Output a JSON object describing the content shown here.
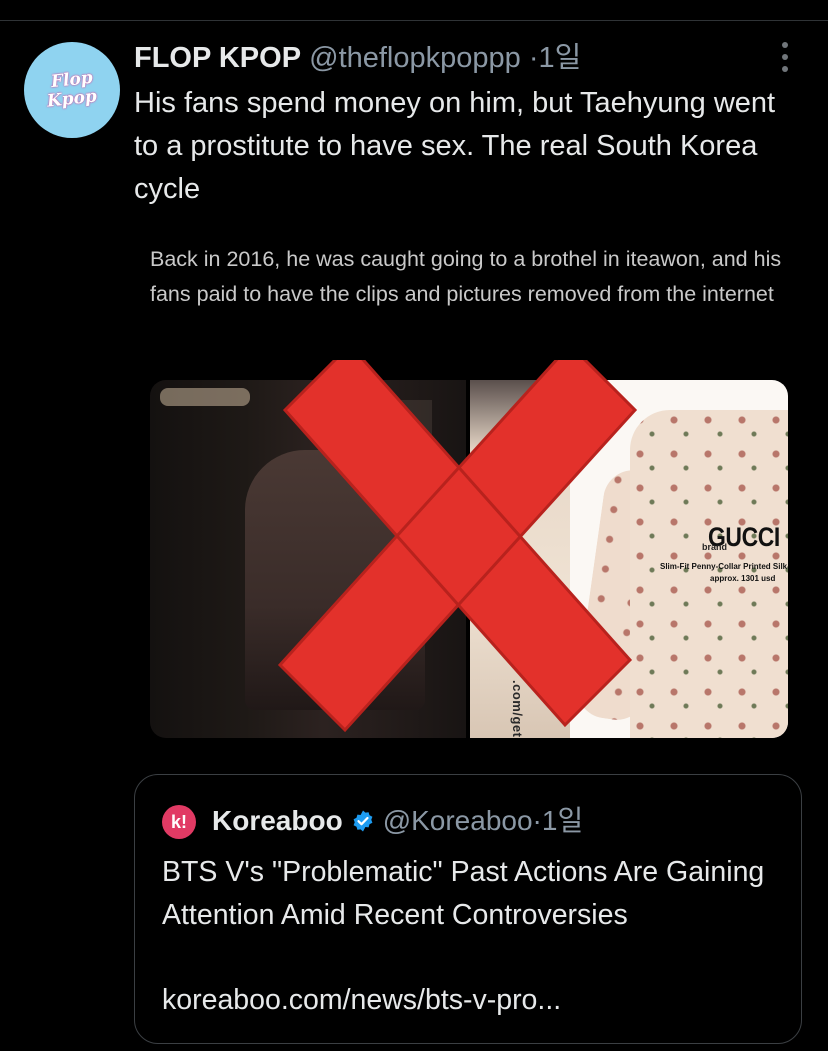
{
  "post": {
    "avatar_text_line1": "Flop",
    "avatar_text_line2": "Kpop",
    "author_name": "FLOP KPOP",
    "author_handle": "@theflopkpoppp",
    "separator": "·",
    "time": "1일",
    "more_icon": "more-vertical-icon",
    "text": "His fans spend money on him, but Taehyung went to a prostitute to have sex. The real South Korea cycle"
  },
  "embedded_image": {
    "caption": "Back in 2016, he was caught going to a brothel in iteawon, and his fans paid to have the clips and pictures removed from the internet",
    "watermark": ".com/getonswag",
    "brand_label": "brand",
    "brand_name": "GUCCI",
    "product_line": "Slim-Fit Penny-Collar Printed Silk-C",
    "price_line": "approx. 1301 usd",
    "overlay_icon": "red-x-icon",
    "overlay_color": "#e3312b"
  },
  "quote": {
    "avatar_icon": "koreaboo-logo-icon",
    "avatar_letter": "k!",
    "author_name": "Koreaboo",
    "verified_icon": "verified-badge-icon",
    "author_handle": "@Koreaboo",
    "separator": "·",
    "time": "1일",
    "title": "BTS V's \"Problematic\" Past Actions Are Gaining Attention Amid Recent Controversies",
    "link": "koreaboo.com/news/bts-v-pro..."
  },
  "colors": {
    "background": "#000000",
    "text_primary": "#e7e9ea",
    "text_secondary": "#8b98a5",
    "verified_blue": "#1d9bf0",
    "koreaboo_pink": "#e13a64",
    "avatar_blue": "#8fd3f0"
  }
}
